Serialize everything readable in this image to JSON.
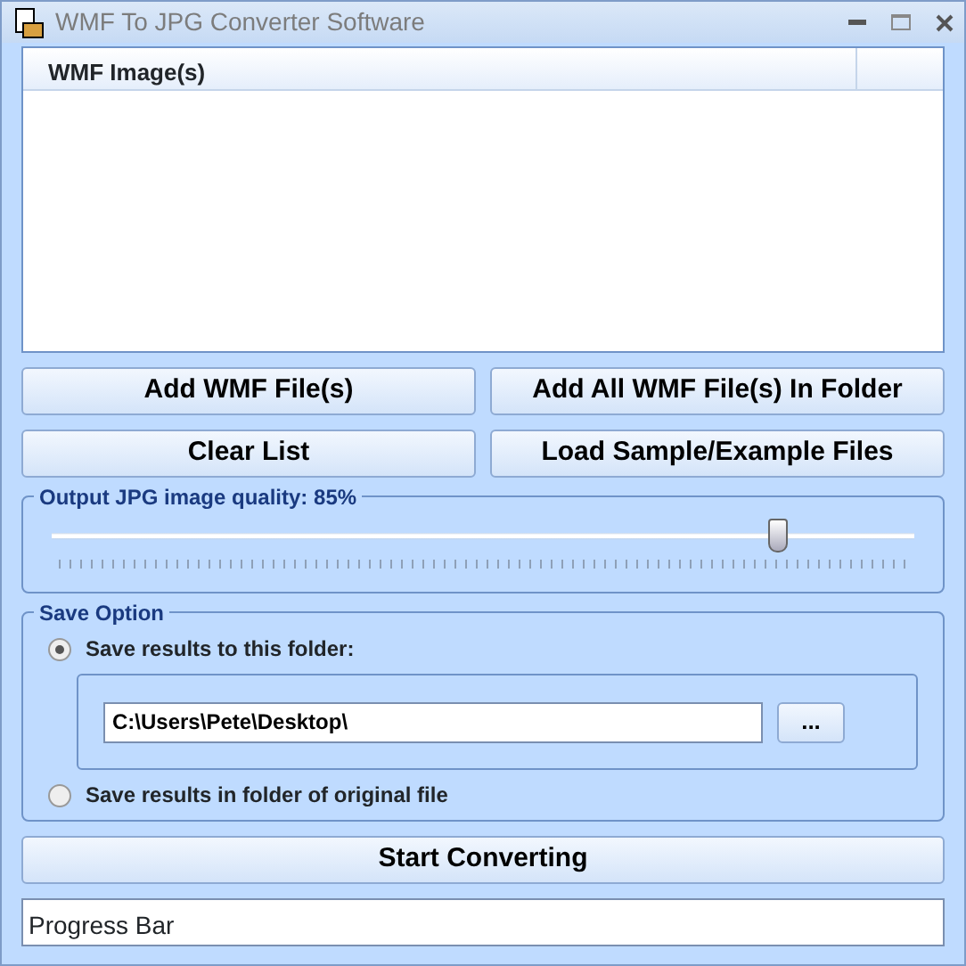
{
  "window": {
    "title": "WMF To JPG Converter Software"
  },
  "file_list": {
    "columns": [
      "WMF Image(s)"
    ]
  },
  "buttons": [
    "Add WMF File(s)",
    "Add All WMF File(s) In Folder",
    "Clear List",
    "Load Sample/Example Files"
  ],
  "quality": {
    "label": "Output JPG image quality: 85%",
    "level": 0.84
  },
  "save_option": {
    "title": "Save Option",
    "options": [
      {
        "label": "Save results to this folder:",
        "selected": true
      },
      {
        "label": "Save results in folder of original file",
        "selected": false
      }
    ],
    "folder": "C:\\Users\\Pete\\Desktop\\",
    "browse": "..."
  },
  "start_button": "Start Converting",
  "progress": {
    "label": "Progress Bar",
    "level": 0
  }
}
